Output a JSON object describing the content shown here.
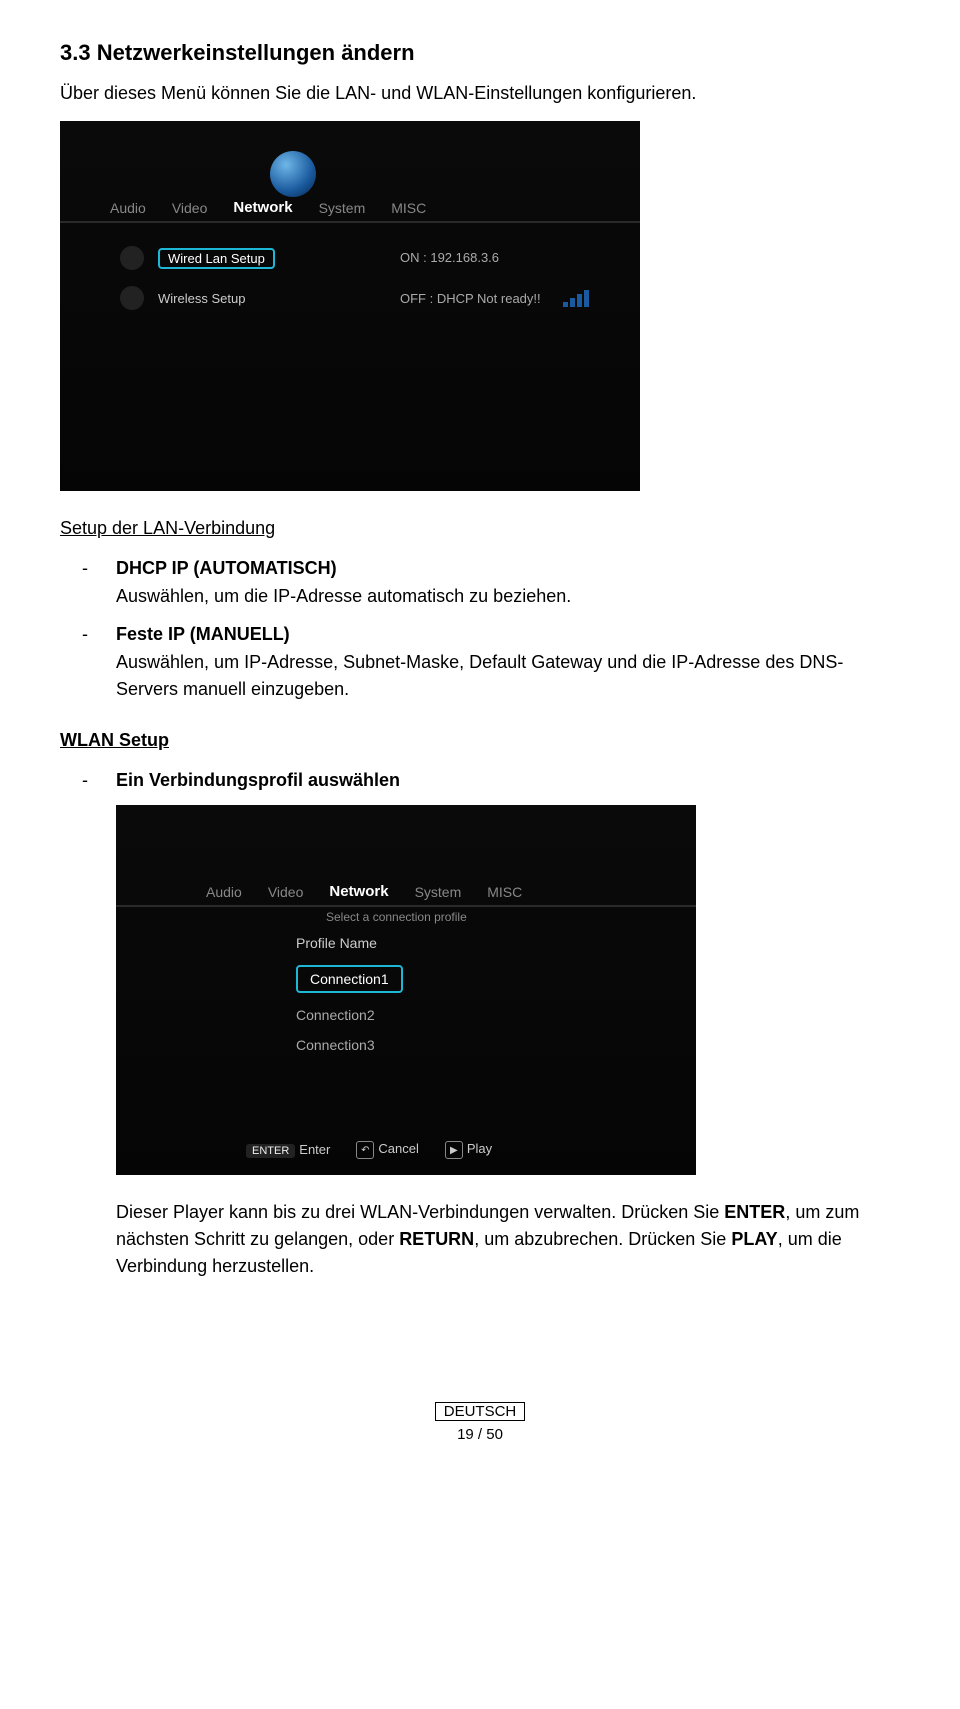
{
  "heading": "3.3 Netzwerkeinstellungen ändern",
  "intro": "Über dieses Menü können Sie die LAN- und WLAN-Einstellungen konfigurieren.",
  "shot1": {
    "tabs": [
      "Audio",
      "Video",
      "Network",
      "System",
      "MISC"
    ],
    "wired_label": "Wired Lan Setup",
    "wired_status": "ON : 192.168.3.6",
    "wireless_label": "Wireless Setup",
    "wireless_status": "OFF : DHCP Not ready!!"
  },
  "lan_heading": "Setup der LAN-Verbindung",
  "lan_items": [
    {
      "title": "DHCP IP (AUTOMATISCH)",
      "body": "Auswählen, um die IP-Adresse automatisch zu beziehen."
    },
    {
      "title": "Feste IP (MANUELL)",
      "body": "Auswählen, um IP-Adresse, Subnet-Maske, Default Gateway und die IP-Adresse des DNS-Servers manuell einzugeben."
    }
  ],
  "wlan_heading": "WLAN Setup",
  "wlan_item_title": "Ein Verbindungsprofil auswählen",
  "shot2": {
    "tabs": [
      "Audio",
      "Video",
      "Network",
      "System",
      "MISC"
    ],
    "subtitle": "Select a connection profile",
    "profile_header": "Profile Name",
    "profiles": [
      "Connection1",
      "Connection2",
      "Connection3"
    ],
    "hints": [
      {
        "key": "ENTER",
        "label": "Enter"
      },
      {
        "key": "↶",
        "label": "Cancel"
      },
      {
        "key": "▶",
        "label": "Play"
      }
    ]
  },
  "para_parts": {
    "p1": "Dieser Player kann bis zu drei WLAN-Verbindungen verwalten. Drücken Sie ",
    "enter": "ENTER",
    "p2": ", um zum nächsten Schritt zu gelangen, oder ",
    "return": "RETURN",
    "p3": ", um abzubrechen. Drücken Sie ",
    "play": "PLAY",
    "p4": ", um die Verbindung herzustellen."
  },
  "footer_label": "DEUTSCH",
  "footer_page": "19 / 50"
}
